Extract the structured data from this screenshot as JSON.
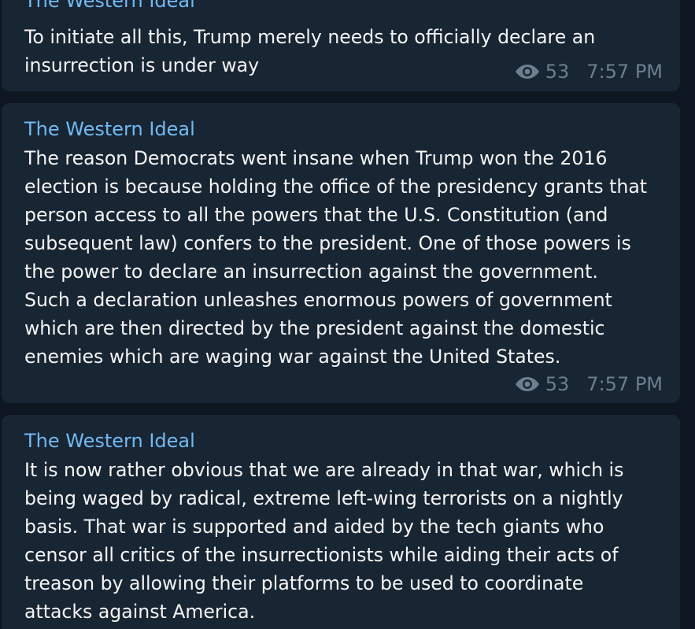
{
  "messages": [
    {
      "channel": "The Western Ideal",
      "text": "To initiate all this, Trump merely needs to officially declare an\ninsurrection is under way",
      "views": "53",
      "time": "7:57 PM",
      "view_icon": "eye-icon"
    },
    {
      "channel": "The Western Ideal",
      "text": "The reason Democrats went insane when Trump won the 2016\nelection is because holding the office of the presidency grants that\nperson access to all the powers that the U.S. Constitution (and\nsubsequent law) confers to the president. One of those powers is\nthe power to declare an insurrection against the government.\nSuch a declaration unleashes enormous powers of government\nwhich are then directed by the president against the domestic\nenemies which are waging war against the United States.",
      "views": "53",
      "time": "7:57 PM",
      "view_icon": "eye-icon"
    },
    {
      "channel": "The Western Ideal",
      "text": "It is now rather obvious that we are already in that war, which is\nbeing waged by radical, extreme left-wing terrorists on a nightly\nbasis. That war is supported and aided by the tech giants who\ncensor all critics of the insurrectionists while aiding their acts of\ntreason by allowing their platforms to be used to coordinate\nattacks against America."
    }
  ],
  "colors": {
    "background": "#0e1621",
    "bubble": "#182533",
    "channel_name": "#71baf2",
    "text": "#f5f5f5",
    "meta": "#6d7f8f"
  }
}
